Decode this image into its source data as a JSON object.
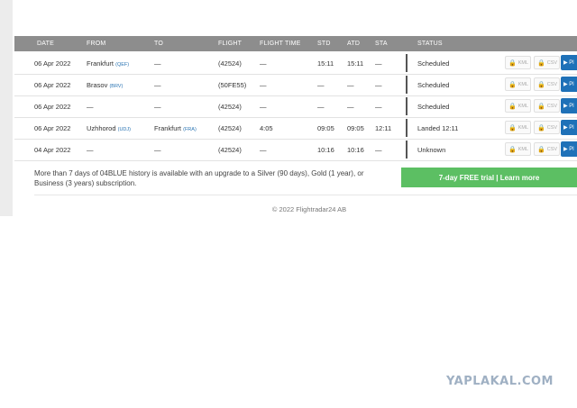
{
  "table": {
    "headers": [
      "DATE",
      "FROM",
      "TO",
      "FLIGHT",
      "FLIGHT TIME",
      "STD",
      "ATD",
      "STA",
      "STATUS"
    ],
    "rows": [
      {
        "date": "06 Apr 2022",
        "from": "Frankfurt",
        "from_code": "(QEF)",
        "to": "—",
        "to_code": "",
        "flight": "(42524)",
        "flight_time": "—",
        "std": "15:11",
        "atd": "15:11",
        "sta": "—",
        "status": "Scheduled"
      },
      {
        "date": "06 Apr 2022",
        "from": "Brasov",
        "from_code": "(BRV)",
        "to": "—",
        "to_code": "",
        "flight": "(50FE55)",
        "flight_time": "—",
        "std": "—",
        "atd": "—",
        "sta": "—",
        "status": "Scheduled"
      },
      {
        "date": "06 Apr 2022",
        "from": "—",
        "from_code": "",
        "to": "—",
        "to_code": "",
        "flight": "(42524)",
        "flight_time": "—",
        "std": "—",
        "atd": "—",
        "sta": "—",
        "status": "Scheduled"
      },
      {
        "date": "06 Apr 2022",
        "from": "Uzhhorod",
        "from_code": "(UDJ)",
        "to": "Frankfurt",
        "to_code": "(FRA)",
        "flight": "(42524)",
        "flight_time": "4:05",
        "std": "09:05",
        "atd": "09:05",
        "sta": "12:11",
        "status": "Landed 12:11"
      },
      {
        "date": "04 Apr 2022",
        "from": "—",
        "from_code": "",
        "to": "—",
        "to_code": "",
        "flight": "(42524)",
        "flight_time": "—",
        "std": "10:16",
        "atd": "10:16",
        "sta": "—",
        "status": "Unknown"
      }
    ],
    "kml_label": "KML",
    "csv_label": "CSV",
    "play_label": "Pl"
  },
  "upgrade": {
    "text": "More than 7 days of 04BLUE history is available with an upgrade to a Silver (90 days), Gold (1 year), or Business (3 years) subscription.",
    "trial_label": "7-day FREE trial | Learn more"
  },
  "footer": {
    "copyright": "© 2022 Flightradar24 AB"
  },
  "watermark": "YAPLAKAL.COM",
  "colors": {
    "header_bg": "#8d8d8d",
    "trial_green": "#5cbf63",
    "play_blue": "#1f71b8",
    "code_blue": "#2a74b3"
  }
}
